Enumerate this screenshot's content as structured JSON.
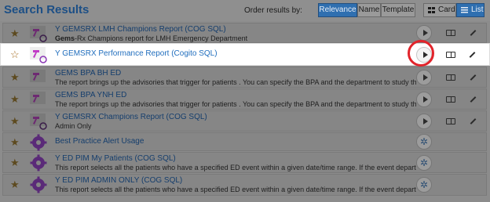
{
  "header": {
    "title": "Search Results",
    "order_label": "Order results by:",
    "order_options": [
      "Relevance",
      "Name",
      "Template"
    ],
    "view_options": [
      "Card",
      "List"
    ]
  },
  "rows": [
    {
      "name": "Y GEMSRX LMH Champions Report (COG SQL)",
      "desc_bold": "Gems",
      "desc": "-Rx Champions report for LMH Emergency Department",
      "action": "run"
    },
    {
      "name": "Y GEMSRX Performance Report (Cogito SQL)",
      "desc_bold": "",
      "desc": "",
      "action": "run"
    },
    {
      "name": "GEMS BPA BH ED",
      "desc_bold": "",
      "desc": "The report brings up the advisories that trigger for patients . You can specify the BPA and the department to study the ...",
      "action": "run"
    },
    {
      "name": "GEMS BPA YNH ED",
      "desc_bold": "",
      "desc": "The report brings up the advisories that trigger for patients . You can specify the BPA and the department to study the ...",
      "action": "run"
    },
    {
      "name": "Y GEMSRX Champions Report (COG SQL)",
      "desc_bold": "",
      "desc": "Admin Only",
      "action": "run"
    },
    {
      "name": "Best Practice Alert Usage",
      "desc_bold": "",
      "desc": "",
      "action": "star"
    },
    {
      "name": "Y ED PIM My Patients (COG SQL)",
      "desc_bold": "",
      "desc": "This report selects all the patients who have a specified ED event within a given date/time range. If the event departm...",
      "action": "star"
    },
    {
      "name": "Y ED PIM ADMIN ONLY (COG SQL)",
      "desc_bold": "",
      "desc": "This report selects all the patients who have a specified ED event within a given date/time range. If the event departm...",
      "action": "star"
    }
  ],
  "icons": {
    "favorite": "star-icon",
    "report": "report-hammer-icon",
    "template": "template-gear-icon",
    "run": "play-icon",
    "details": "book-icon",
    "edit": "pencil-icon"
  },
  "colors": {
    "accent": "#2f6fb0",
    "highlight_ring": "#e2242b",
    "link": "#1f6dbd"
  }
}
